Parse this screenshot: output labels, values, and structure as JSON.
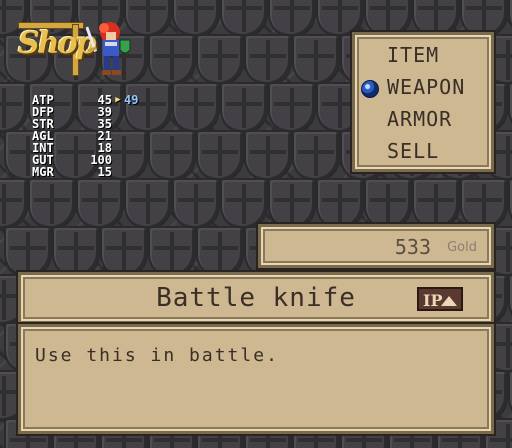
{
  "logo": {
    "text": "Shop"
  },
  "stats": [
    {
      "label": "ATP",
      "value": "45",
      "arrow": "▶",
      "new_value": "49"
    },
    {
      "label": "DFP",
      "value": "39",
      "arrow": "",
      "new_value": ""
    },
    {
      "label": "STR",
      "value": "35",
      "arrow": "",
      "new_value": ""
    },
    {
      "label": "AGL",
      "value": "21",
      "arrow": "",
      "new_value": ""
    },
    {
      "label": "INT",
      "value": "18",
      "arrow": "",
      "new_value": ""
    },
    {
      "label": "GUT",
      "value": "100",
      "arrow": "",
      "new_value": ""
    },
    {
      "label": "MGR",
      "value": "15",
      "arrow": "",
      "new_value": ""
    }
  ],
  "menu": {
    "items": [
      {
        "label": "ITEM"
      },
      {
        "label": "WEAPON"
      },
      {
        "label": "ARMOR"
      },
      {
        "label": "SELL"
      }
    ],
    "selected": "WEAPON"
  },
  "gold": {
    "amount": "533",
    "unit": "Gold"
  },
  "item": {
    "name": "Battle knife",
    "type_badge": "IP",
    "description": "Use this in battle."
  },
  "colors": {
    "panel": "#cdb892",
    "panel_border": "#7a6a4e",
    "text_dark": "#3a2e26",
    "stat_new": "#8ec8ff",
    "logo_gold": "#e8c050",
    "background": "#3b3a3d"
  }
}
